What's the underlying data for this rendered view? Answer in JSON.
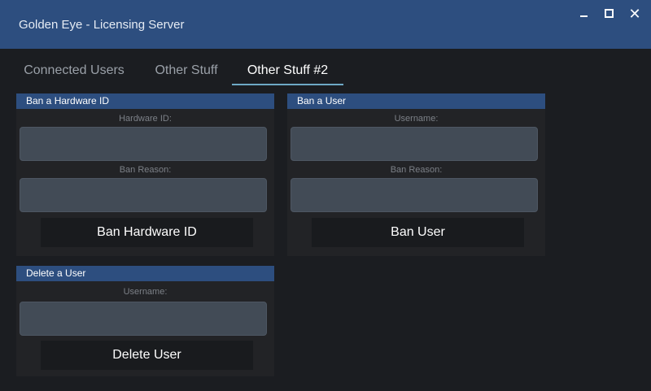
{
  "window": {
    "title": "Golden Eye - Licensing Server",
    "controls": {
      "minimize": "minimize",
      "maximize": "maximize",
      "close": "✕"
    }
  },
  "tabs": [
    {
      "label": "Connected Users",
      "active": false
    },
    {
      "label": "Other Stuff",
      "active": false
    },
    {
      "label": "Other Stuff #2",
      "active": true
    }
  ],
  "ban_hardware": {
    "header": "Ban a Hardware ID",
    "hwid_label": "Hardware ID:",
    "hwid_value": "",
    "reason_label": "Ban Reason:",
    "reason_value": "",
    "button": "Ban Hardware ID"
  },
  "ban_user": {
    "header": "Ban a User",
    "username_label": "Username:",
    "username_value": "",
    "reason_label": "Ban Reason:",
    "reason_value": "",
    "button": "Ban User"
  },
  "delete_user": {
    "header": "Delete a User",
    "username_label": "Username:",
    "username_value": "",
    "button": "Delete User"
  },
  "colors": {
    "titlebar": "#2d4e7f",
    "background": "#1b1d21",
    "panel": "#222326",
    "field": "#424b56",
    "button": "#191b1e",
    "tab_underline": "#6ea9c6"
  }
}
